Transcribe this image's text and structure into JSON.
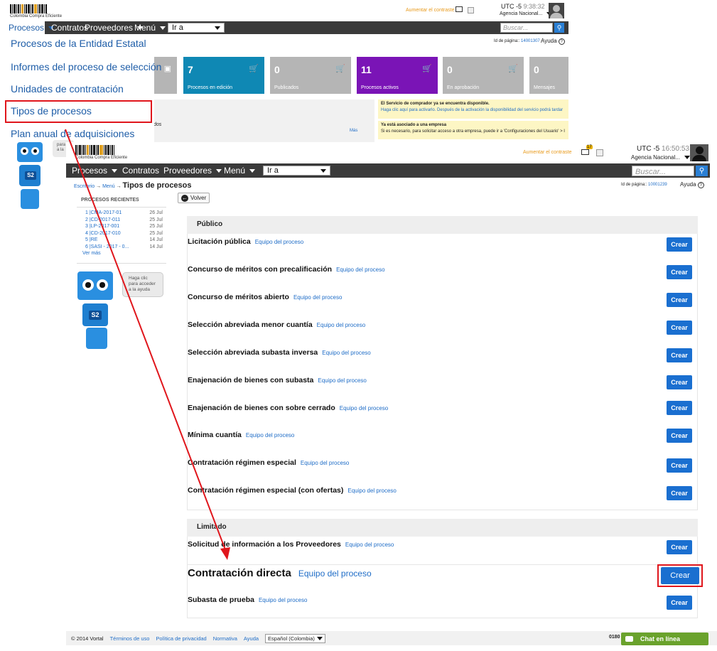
{
  "brand": {
    "name": "Colombia Compra Eficiente"
  },
  "back_window": {
    "top_link": "Aumentar el contraste",
    "utc_label": "UTC -5",
    "time": "9:38:32",
    "agency": "Agencia Nacional...",
    "nav": [
      "Procesos",
      "Contratos",
      "Proveedores",
      "Menú"
    ],
    "go_to": "Ir a",
    "search_placeholder": "Buscar...",
    "page_id_label": "Id de página::",
    "page_id": "14001307",
    "help": "Ayuda",
    "dropdown": [
      "Procesos de la Entidad Estatal",
      "Informes del proceso de selección",
      "Unidades de contratación",
      "Tipos de procesos",
      "Plan anual de adquisiciones"
    ],
    "tiles": [
      {
        "count": "7",
        "label": "Procesos en edición",
        "color": "#0f88b4"
      },
      {
        "count": "0",
        "label": "Publicados",
        "color": "#b5b5b5"
      },
      {
        "count": "11",
        "label": "Procesos activos",
        "color": "#7a14b6"
      },
      {
        "count": "0",
        "label": "En aprobación",
        "color": "#b5b5b5"
      },
      {
        "count": "0",
        "label": "Mensajes",
        "color": "#b5b5b5"
      }
    ],
    "fragment_dos": "dos",
    "more": "Más",
    "notice1_title": "El Servicio de comprador ya se encuentra disponible.",
    "notice1_text": "Haga clic aquí para activarlo. Después de la activación la disponibilidad del servicio podrá tardar",
    "notice2_title": "Ya está asociado a una empresa",
    "notice2_text": "Si es necesario, para solicitar acceso a otra empresa, puede ir a 'Configuraciones del Usuario' > I",
    "bubble": [
      "para",
      "a la"
    ]
  },
  "front_window": {
    "top_link": "Aumentar el contraste",
    "mail_count": "17",
    "utc_label": "UTC -5",
    "time": "16:50:53",
    "agency": "Agencia Nacional...",
    "nav": [
      "Procesos",
      "Contratos",
      "Proveedores",
      "Menú"
    ],
    "go_to": "Ir a",
    "search_placeholder": "Buscar...",
    "breadcrumb": {
      "home": "Escritorio",
      "arrow": "→",
      "menu": "Menú",
      "current": "Tipos de procesos"
    },
    "page_id_label": "Id de página::",
    "page_id": "10001239",
    "help": "Ayuda",
    "back_button": "Volver",
    "recent": {
      "title": "PROCESOS RECIENTES",
      "items": [
        {
          "name": "1 |CMA-2017-01",
          "date": "26 Jul"
        },
        {
          "name": "2 |CD-2017-011",
          "date": "25 Jul"
        },
        {
          "name": "3 |LP-2017-001",
          "date": "25 Jul"
        },
        {
          "name": "4 |CD-2017-010",
          "date": "25 Jul"
        },
        {
          "name": "5 |RE",
          "date": "14 Jul"
        },
        {
          "name": "6 |SASI - 2017 - 0...",
          "date": "14 Jul"
        }
      ],
      "more": "Ver más"
    },
    "help_bubble": [
      "Haga clic",
      "para acceder",
      "a la ayuda"
    ],
    "robot_label": "S2",
    "sections": [
      {
        "title": "Público",
        "rows": [
          {
            "name": "Licitación pública",
            "link": "Equipo del proceso"
          },
          {
            "name": "Concurso de méritos con precalificación",
            "link": "Equipo del proceso"
          },
          {
            "name": "Concurso de méritos abierto",
            "link": "Equipo del proceso"
          },
          {
            "name": "Selección abreviada menor cuantía",
            "link": "Equipo del proceso"
          },
          {
            "name": "Selección abreviada subasta inversa",
            "link": "Equipo del proceso"
          },
          {
            "name": "Enajenación de bienes con subasta",
            "link": "Equipo del proceso"
          },
          {
            "name": "Enajenación de bienes con sobre cerrado",
            "link": "Equipo del proceso"
          },
          {
            "name": "Mínima cuantía",
            "link": "Equipo del proceso"
          },
          {
            "name": "Contratación régimen especial",
            "link": "Equipo del proceso"
          },
          {
            "name": "Contratación régimen especial (con ofertas)",
            "link": "Equipo del proceso"
          }
        ]
      },
      {
        "title": "Limitado",
        "rows": [
          {
            "name": "Solicitud de información a los Proveedores",
            "link": "Equipo del proceso"
          },
          {
            "name": "Contratación directa",
            "link": "Equipo del proceso"
          },
          {
            "name": "Subasta de prueba",
            "link": "Equipo del proceso"
          }
        ]
      }
    ],
    "create_label": "Crear",
    "footer": {
      "copyright": "© 2014 Vortal",
      "links": [
        "Términos de uso",
        "Política de privacidad",
        "Normativa",
        "Ayuda"
      ],
      "language": "Español (Colombia)",
      "phone_partial": "0180",
      "chat": "Chat en línea"
    }
  },
  "colors": {
    "nav": "#3a3a3a",
    "highlight": "#e0161c",
    "button": "#1a6fd0",
    "chat": "#6aa22c"
  }
}
